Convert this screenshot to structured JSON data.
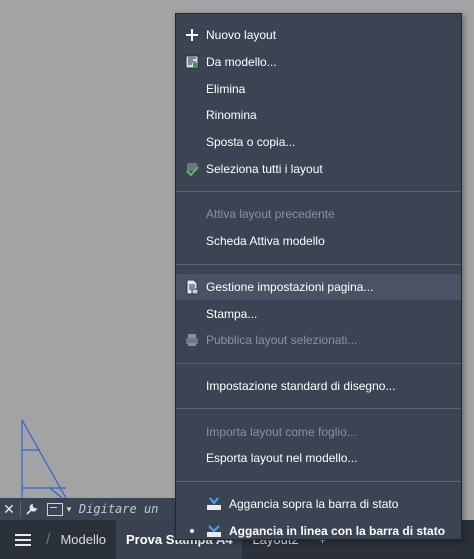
{
  "command_line": {
    "close_icon": "close-icon",
    "customize_icon": "wrench-icon",
    "prompt_text": "Digitare un"
  },
  "tabbar": {
    "menu_icon": "hamburger-menu-icon",
    "tabs": [
      {
        "label": "Modello"
      },
      {
        "label": "Prova Stampa A4"
      },
      {
        "label": "Layout2"
      },
      {
        "label": "+"
      }
    ]
  },
  "context_menu": {
    "groups": [
      [
        {
          "label": "Nuovo layout",
          "icon": "plus-icon",
          "enabled": true
        },
        {
          "label": "Da modello...",
          "icon": "template-icon",
          "enabled": true
        },
        {
          "label": "Elimina",
          "enabled": true
        },
        {
          "label": "Rinomina",
          "enabled": true
        },
        {
          "label": "Sposta o copia...",
          "enabled": true
        },
        {
          "label": "Seleziona tutti i layout",
          "icon": "select-all-icon",
          "enabled": true
        }
      ],
      [
        {
          "label": "Attiva layout precedente",
          "enabled": false
        },
        {
          "label": "Scheda Attiva modello",
          "enabled": true
        }
      ],
      [
        {
          "label": "Gestione impostazioni pagina...",
          "icon": "page-setup-icon",
          "enabled": true,
          "hovered": true
        },
        {
          "label": "Stampa...",
          "enabled": true
        },
        {
          "label": "Pubblica layout selezionati...",
          "icon": "publish-icon",
          "enabled": false
        }
      ],
      [
        {
          "label": "Impostazione standard di disegno...",
          "enabled": true
        }
      ],
      [
        {
          "label": "Importa layout come foglio...",
          "enabled": false
        },
        {
          "label": "Esporta layout nel modello...",
          "enabled": true
        }
      ],
      [
        {
          "label": "Aggancia sopra la barra di stato",
          "icon": "dock-above-icon",
          "enabled": true
        },
        {
          "label": "Aggancia in linea con la barra di stato",
          "icon": "dock-inline-icon",
          "enabled": true,
          "checked": true
        }
      ]
    ]
  },
  "colors": {
    "menu_bg": "#3b4453",
    "menu_hover": "#4a5363",
    "disabled_text": "#8b929d",
    "canvas_bg": "#a3a3a3",
    "drawing_line": "#2f63d6"
  }
}
